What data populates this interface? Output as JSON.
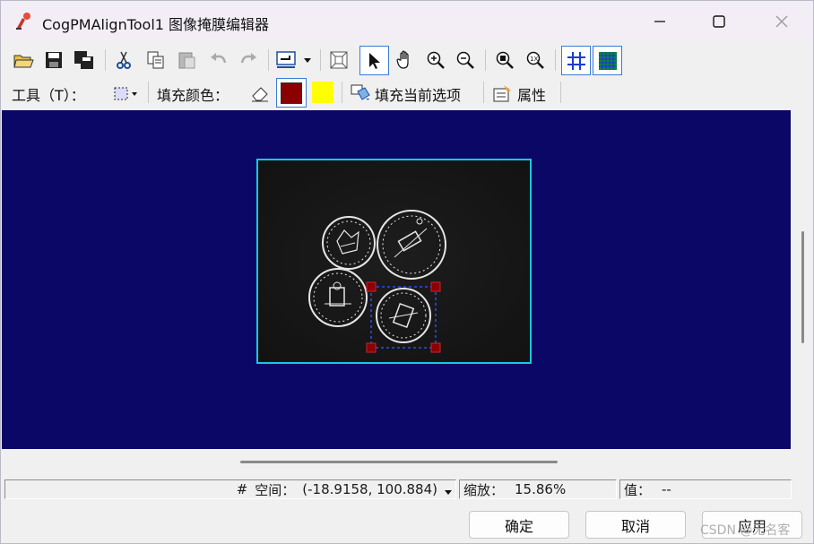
{
  "window": {
    "title": "CogPMAlignTool1 图像掩膜编辑器"
  },
  "toolbar_row1": {
    "icons": [
      "open-folder-icon",
      "save-icon",
      "save-all-icon",
      "cut-icon",
      "copy-icon",
      "paste-icon",
      "undo-icon",
      "redo-icon",
      "export-icon",
      "dropdown-arrow-icon",
      "fit-icon",
      "pointer-icon",
      "pan-hand-icon",
      "zoom-in-icon",
      "zoom-out-icon",
      "zoom-box-icon",
      "zoom-100-icon",
      "grid-icon",
      "fine-grid-icon"
    ]
  },
  "toolbar_row2": {
    "tool_label": "工具（T）：",
    "fill_color_label": "填充颜色：",
    "fill_current_label": "填充当前选项",
    "properties_label": "属性",
    "colors": {
      "primary": "#8b0000",
      "secondary": "#ffff00"
    }
  },
  "canvas": {
    "background": "#0a0766",
    "frame_color": "#19c7e0",
    "mask_handle_color": "#8b0000"
  },
  "status": {
    "hash": "#",
    "space_label": "空间：",
    "coordinates": "(-18.9158, 100.884)",
    "zoom_label": "缩放：",
    "zoom_value": "15.86%",
    "value_label": "值：",
    "value": "--"
  },
  "buttons": {
    "ok": "确定",
    "cancel": "取消",
    "apply": "应用"
  },
  "watermark": "CSDN @无名客"
}
